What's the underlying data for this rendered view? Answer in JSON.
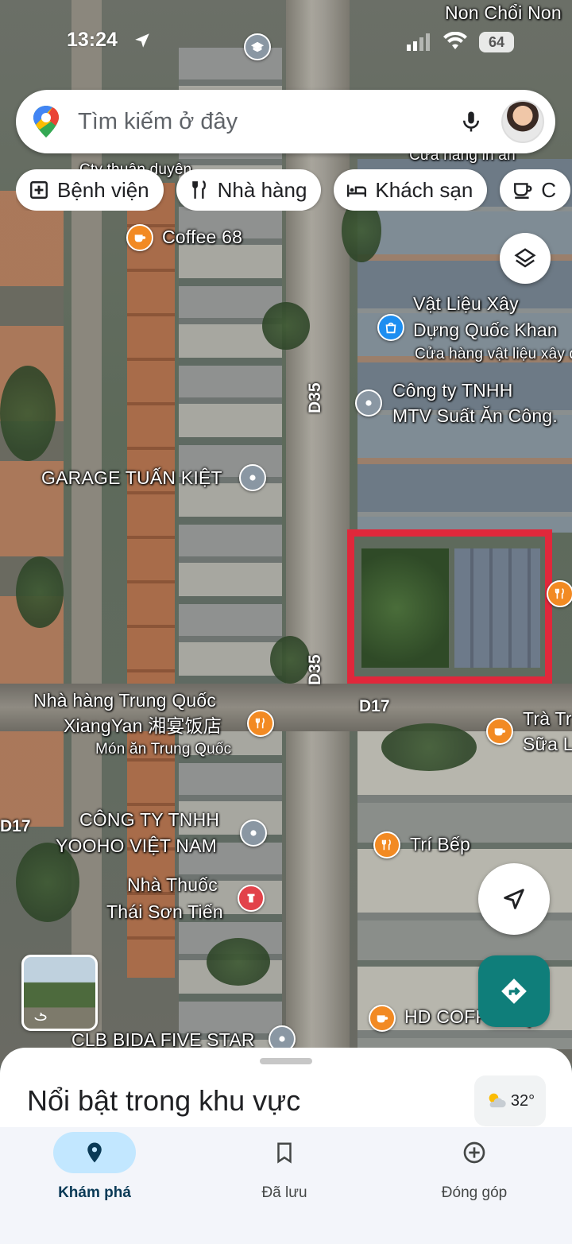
{
  "status_bar": {
    "time": "13:24",
    "battery": "64"
  },
  "top_label": "Non Chổi Non",
  "search": {
    "placeholder": "Tìm kiếm ở đây"
  },
  "chips": [
    {
      "label": "Bệnh viện",
      "icon": "hospital-icon"
    },
    {
      "label": "Nhà hàng",
      "icon": "restaurant-icon"
    },
    {
      "label": "Khách sạn",
      "icon": "hotel-icon"
    },
    {
      "label": "C",
      "icon": "coffee-icon"
    }
  ],
  "map": {
    "roads": {
      "d35_top": "D35",
      "d35_bottom": "D35",
      "d17_right": "D17",
      "d17_left": "D17"
    },
    "places": {
      "partial_top": "Cửa hàng in ấn",
      "partial_top_left": "Cty thuận duyên",
      "coffee68": "Coffee 68",
      "vat_lieu_1": "Vật Liệu Xây",
      "vat_lieu_2": "Dựng Quốc Khan",
      "vat_lieu_sub": "Cửa hàng vật liệu xây d",
      "cong_ty_1": "Công ty TNHH",
      "cong_ty_2": "MTV Suất Ăn Công.",
      "garage": "GARAGE TUẤN KIỆT",
      "nha_hang_1": "Nhà hàng Trung Quốc",
      "nha_hang_2": "XiangYan 湘宴饭店",
      "nha_hang_sub": "Món ăn Trung Quốc",
      "tra_sua_1": "Trà Tr",
      "tra_sua_2": "Sữa L",
      "yooho_1": "CÔNG TY TNHH",
      "yooho_2": "YOOHO VIỆT NAM",
      "tri_bep": "Trí Bếp",
      "nha_thuoc_1": "Nhà Thuốc",
      "nha_thuoc_2": "Thái Sơn Tiến",
      "hd_coffee": "HD COFFEE ap",
      "clb_bida": "CLB BIDA FIVE STAR"
    }
  },
  "bottom_sheet": {
    "title": "Nổi bật trong khu vực",
    "weather": "32°"
  },
  "nav": [
    {
      "label": "Khám phá",
      "active": true
    },
    {
      "label": "Đã lưu",
      "active": false
    },
    {
      "label": "Đóng góp",
      "active": false
    }
  ],
  "colors": {
    "highlight": "#e0283b",
    "directions_button": "#0f7e7a",
    "active_nav": "#c2e7ff"
  }
}
